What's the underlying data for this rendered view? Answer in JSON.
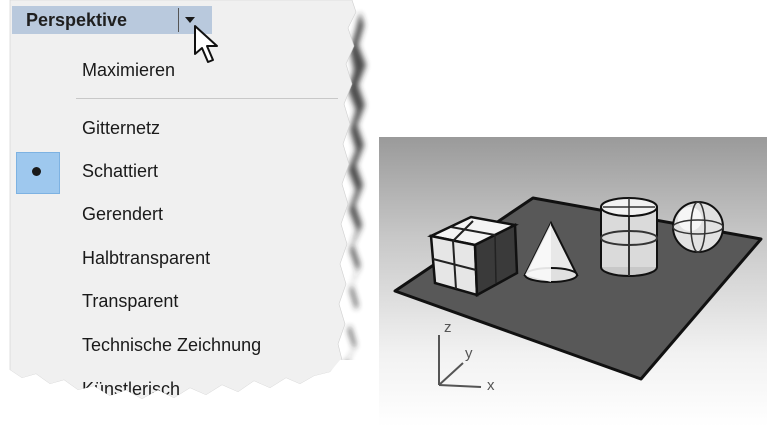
{
  "menu": {
    "title": "Perspektive",
    "items": [
      {
        "label": "Maximieren",
        "checked": false
      },
      {
        "label": "Gitternetz",
        "checked": false
      },
      {
        "label": "Schattiert",
        "checked": true
      },
      {
        "label": "Gerendert",
        "checked": false
      },
      {
        "label": "Halbtransparent",
        "checked": false
      },
      {
        "label": "Transparent",
        "checked": false
      },
      {
        "label": "Technische Zeichnung",
        "checked": false
      },
      {
        "label": "Künstlerisch",
        "checked": false
      }
    ]
  },
  "viewport": {
    "axes": {
      "z": "z",
      "y": "y",
      "x": "x"
    }
  },
  "colors": {
    "menu_bg": "#f0f0f0",
    "title_bar": "#b9c9dd",
    "checked_highlight": "#9ec8ee",
    "ground_plane": "#585858"
  },
  "icons": [
    "mouse-cursor-icon",
    "dropdown-arrow-icon",
    "checked-dot-icon"
  ]
}
